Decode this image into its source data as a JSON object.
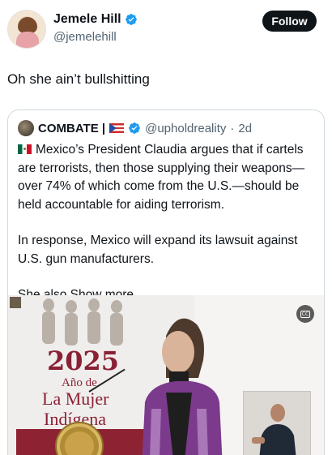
{
  "post": {
    "author_name": "Jemele Hill",
    "author_handle": "@jemelehill",
    "follow_label": "Follow",
    "text": "Oh she ain’t bullshitting"
  },
  "quoted": {
    "author_name": "COMBATE",
    "name_separator": "|",
    "author_handle": "@upholdreality",
    "dot": "·",
    "time": "2d",
    "paragraph1": "Mexico’s President Claudia argues that if cartels are terrorists, then those supplying their weapons—over 74% of which come from the U.S.—should be held accountable for aiding terrorism.",
    "paragraph2": "In response, Mexico will expand its lawsuit against U.S. gun manufacturers.",
    "paragraph3_start": "She also ",
    "show_more_label": "Show more",
    "media": {
      "year": "2025",
      "line1": "Año de",
      "line2": "La Mujer",
      "line3": "Indígena",
      "cc_label": "CC"
    }
  },
  "colors": {
    "verified": "#1d9bf0",
    "accent_text": "#8b2035",
    "follow_bg": "#0f1419"
  },
  "icons": {
    "verified": "verified-badge-icon",
    "flag_pr": "puerto-rico-flag-icon",
    "flag_mx": "mexico-flag-icon",
    "cc": "closed-captions-icon"
  }
}
